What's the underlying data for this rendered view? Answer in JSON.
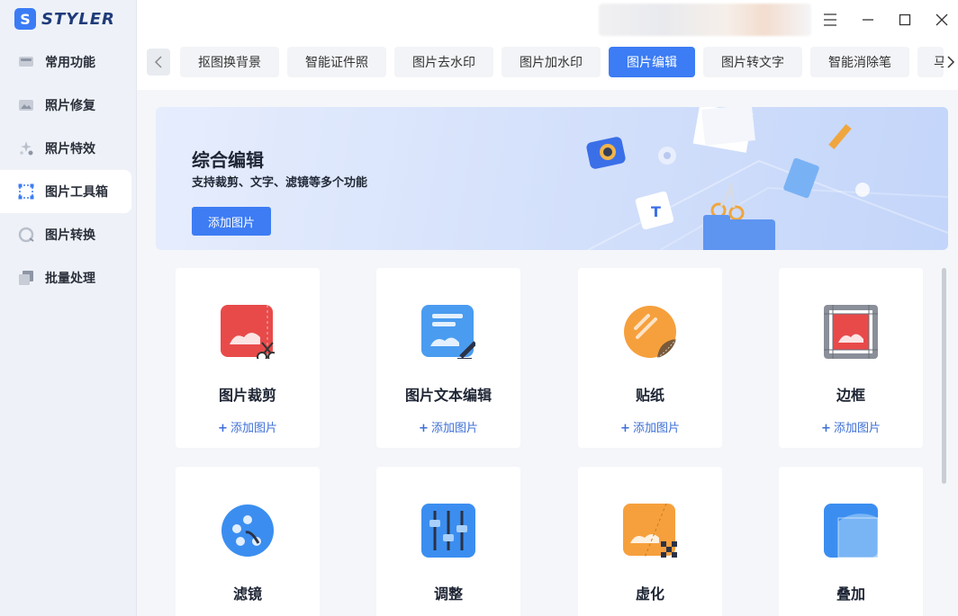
{
  "app": {
    "logo_letter": "S",
    "logo_text": "STYLER"
  },
  "sidebar": {
    "items": [
      {
        "label": "常用功能",
        "icon": "grid-icon"
      },
      {
        "label": "照片修复",
        "icon": "photo-repair-icon"
      },
      {
        "label": "照片特效",
        "icon": "sparkle-icon"
      },
      {
        "label": "图片工具箱",
        "icon": "toolbox-icon",
        "active": true
      },
      {
        "label": "图片转换",
        "icon": "convert-icon"
      },
      {
        "label": "批量处理",
        "icon": "batch-icon"
      }
    ]
  },
  "window_controls": [
    "menu-icon",
    "minimize-icon",
    "maximize-icon",
    "close-icon"
  ],
  "tabs": [
    "抠图换背景",
    "智能证件照",
    "图片去水印",
    "图片加水印",
    "图片编辑",
    "图片转文字",
    "智能消除笔",
    "马"
  ],
  "active_tab": "图片编辑",
  "banner": {
    "title": "综合编辑",
    "subtitle": "支持裁剪、文字、滤镜等多个功能",
    "button": "添加图片"
  },
  "cards": [
    {
      "title": "图片裁剪",
      "add_label": "添加图片",
      "icon": "crop-icon"
    },
    {
      "title": "图片文本编辑",
      "add_label": "添加图片",
      "icon": "text-edit-icon"
    },
    {
      "title": "贴纸",
      "add_label": "添加图片",
      "icon": "sticker-icon"
    },
    {
      "title": "边框",
      "add_label": "添加图片",
      "icon": "frame-icon"
    },
    {
      "title": "滤镜",
      "icon": "filter-icon"
    },
    {
      "title": "调整",
      "icon": "adjust-icon"
    },
    {
      "title": "虚化",
      "icon": "blur-icon"
    },
    {
      "title": "叠加",
      "icon": "overlay-icon"
    }
  ],
  "colors": {
    "accent": "#3c7cf4",
    "sidebar_bg": "#eef2f8",
    "card_bg": "#ffffff"
  }
}
